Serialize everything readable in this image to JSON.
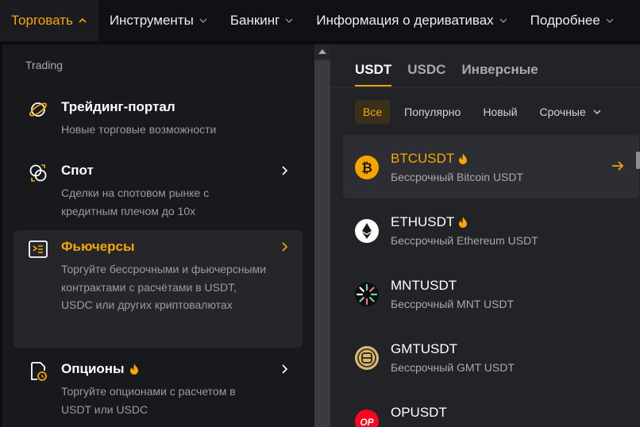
{
  "nav": {
    "items": [
      {
        "label": "Торговать",
        "active": true
      },
      {
        "label": "Инструменты",
        "active": false
      },
      {
        "label": "Банкинг",
        "active": false
      },
      {
        "label": "Информация о деривативах",
        "active": false
      },
      {
        "label": "Подробнее",
        "active": false
      }
    ]
  },
  "left_menu": {
    "section_label": "Trading",
    "items": [
      {
        "title": "Трейдинг-портал",
        "desc": "Новые торговые возможности",
        "icon": "planet-icon"
      },
      {
        "title": "Спот",
        "desc": "Сделки на спотовом рынке с кредитным плечом до 10х",
        "icon": "spot-exchange-icon"
      },
      {
        "title": "Фьючерсы",
        "desc": "Торгуйте бессрочными и фьючерсными контрактами с расчётами в USDT, USDC или других криптовалютах",
        "icon": "futures-icon"
      },
      {
        "title": "Опционы",
        "desc": "Торгуйте опционами с расчетом в USDT или USDC",
        "icon": "options-icon"
      }
    ]
  },
  "right_panel": {
    "tabs": [
      {
        "label": "USDT",
        "active": true
      },
      {
        "label": "USDC",
        "active": false
      },
      {
        "label": "Инверсные",
        "active": false
      }
    ],
    "filters": [
      {
        "label": "Все",
        "active": true
      },
      {
        "label": "Популярно",
        "active": false
      },
      {
        "label": "Новый",
        "active": false
      },
      {
        "label": "Срочные",
        "active": false
      }
    ],
    "coins": [
      {
        "name": "BTCUSDT",
        "desc": "Бессрочный Bitcoin USDT",
        "hot": true
      },
      {
        "name": "ETHUSDT",
        "desc": "Бессрочный Ethereum USDT",
        "hot": true
      },
      {
        "name": "MNTUSDT",
        "desc": "Бессрочный MNT USDT",
        "hot": false
      },
      {
        "name": "GMTUSDT",
        "desc": "Бессрочный GMT USDT",
        "hot": false
      },
      {
        "name": "OPUSDT",
        "desc": "",
        "hot": false
      }
    ]
  },
  "colors": {
    "accent": "#f7a600",
    "panel_left": "#18191c",
    "panel_right": "#222327",
    "nav_bg": "#101114"
  }
}
